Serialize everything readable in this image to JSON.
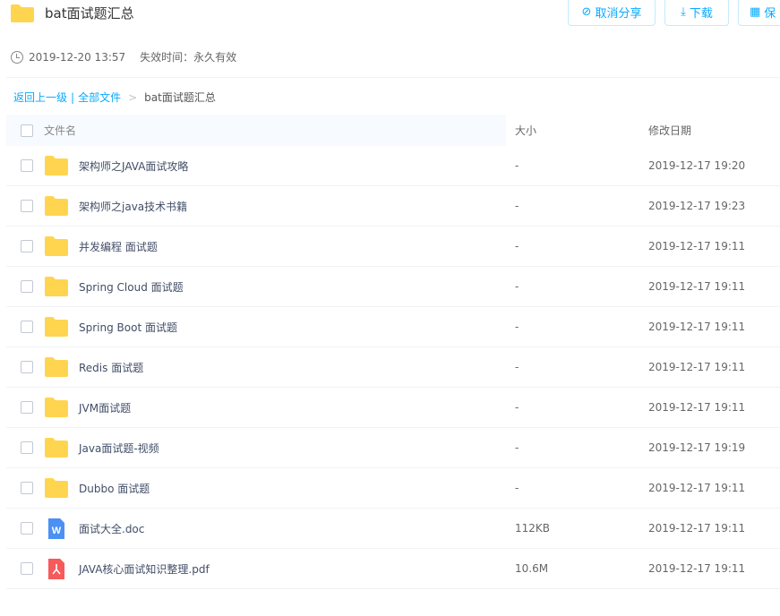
{
  "header": {
    "title": "bat面试题汇总",
    "buttons": [
      {
        "label": "取消分享",
        "icon": "ban-icon"
      },
      {
        "label": "下载",
        "icon": "download-icon"
      },
      {
        "label": "保",
        "icon": "save-icon"
      }
    ]
  },
  "meta": {
    "time": "2019-12-20 13:57",
    "expire": "失效时间：永久有效"
  },
  "breadcrumb": {
    "back": "返回上一级",
    "divider": "|",
    "all": "全部文件",
    "sep": ">",
    "current": "bat面试题汇总"
  },
  "table": {
    "columns": [
      "文件名",
      "大小",
      "修改日期"
    ],
    "rows": [
      {
        "type": "folder",
        "name": "架构师之JAVA面试攻略",
        "size": "-",
        "date": "2019-12-17 19:20"
      },
      {
        "type": "folder",
        "name": "架构师之java技术书籍",
        "size": "-",
        "date": "2019-12-17 19:23"
      },
      {
        "type": "folder",
        "name": "并发编程 面试题",
        "size": "-",
        "date": "2019-12-17 19:11"
      },
      {
        "type": "folder",
        "name": "Spring Cloud 面试题",
        "size": "-",
        "date": "2019-12-17 19:11"
      },
      {
        "type": "folder",
        "name": "Spring Boot 面试题",
        "size": "-",
        "date": "2019-12-17 19:11"
      },
      {
        "type": "folder",
        "name": "Redis 面试题",
        "size": "-",
        "date": "2019-12-17 19:11"
      },
      {
        "type": "folder",
        "name": "JVM面试题",
        "size": "-",
        "date": "2019-12-17 19:11"
      },
      {
        "type": "folder",
        "name": "Java面试题-视频",
        "size": "-",
        "date": "2019-12-17 19:19"
      },
      {
        "type": "folder",
        "name": "Dubbo 面试题",
        "size": "-",
        "date": "2019-12-17 19:11"
      },
      {
        "type": "doc",
        "name": "面试大全.doc",
        "size": "112KB",
        "date": "2019-12-17 19:11"
      },
      {
        "type": "pdf",
        "name": "JAVA核心面试知识整理.pdf",
        "size": "10.6M",
        "date": "2019-12-17 19:11"
      }
    ]
  },
  "colors": {
    "accent": "#09aaff",
    "folder": "#ffd54f",
    "doc": "#4a90f5",
    "pdf": "#f65a5a"
  }
}
